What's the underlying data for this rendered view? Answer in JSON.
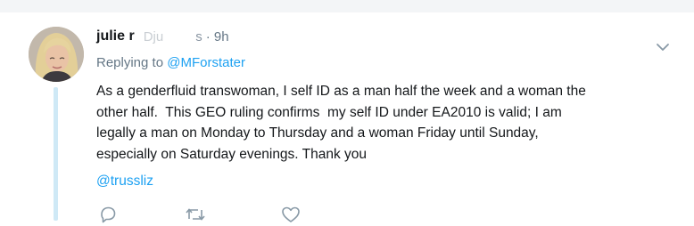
{
  "tweet": {
    "author_name": "julie r",
    "handle_fragment": "Dju",
    "handle_tail": "s",
    "time": "· 9h",
    "replying_prefix": "Replying to",
    "replying_to": "@MForstater",
    "text": "As a genderfluid transwoman, I self ID as a man half the week and a woman the\nother half.  This GEO ruling confirms  my self ID under EA2010 is valid; I am\nlegally a man on Monday to Thursday and a woman Friday until Sunday,\nespecially on Saturday evenings. Thank you",
    "mention": "@trussliz"
  },
  "icons": {
    "menu": "chevron-down-icon",
    "reply": "reply-icon",
    "retweet": "retweet-icon",
    "like": "heart-icon"
  },
  "colors": {
    "link": "#1da1f2",
    "secondary_text": "#657786",
    "thread_line": "#cfe9f6"
  }
}
